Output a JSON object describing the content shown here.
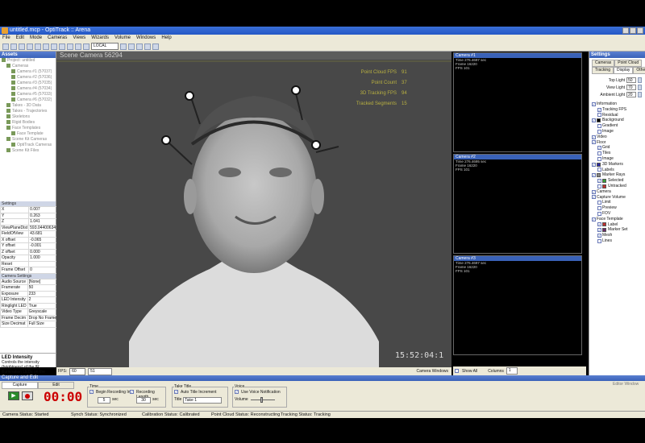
{
  "window": {
    "title": "untitled.mcp - OptiTrack :: Arena"
  },
  "menu": [
    "File",
    "Edit",
    "Mode",
    "Cameras",
    "Views",
    "Wizards",
    "Volume",
    "Windows",
    "Help"
  ],
  "toolbar": {
    "coord_select": "LOCAL"
  },
  "assets": {
    "title": "Assets",
    "tree": [
      "Project: untitled",
      "Cameras",
      "Camera #1 (57037)",
      "Camera #2 (57036)",
      "Camera #3 (57035)",
      "Camera #4 (57034)",
      "Camera #5 (57033)",
      "Camera #6 (57032)",
      "Takes - 3D Data",
      "Takes - Trajectories",
      "Skeletons",
      "Rigid Bodies",
      "Face Templates",
      "Face Template",
      "Scene Kit Cameras",
      "OptiTrack Cameras",
      "Scene Kit Files"
    ]
  },
  "properties": {
    "section1": "Settings",
    "rows1": [
      [
        "X",
        "0.007"
      ],
      [
        "Y",
        "0.263"
      ],
      [
        "Z",
        "1.041"
      ],
      [
        "ViewPlaneDist",
        "593.044006347"
      ],
      [
        "FieldOfView",
        "43.681"
      ],
      [
        "X offset",
        "-0.065"
      ],
      [
        "Y offset",
        "-0.001"
      ],
      [
        "Z offset",
        "0.000"
      ],
      [
        "Opacity",
        "1.000"
      ],
      [
        "Reset",
        ""
      ],
      [
        "Frame Offset",
        "0"
      ]
    ],
    "section2": "Camera Settings",
    "rows2": [
      [
        "Audio Source",
        "[None]"
      ],
      [
        "Framerate",
        "50"
      ],
      [
        "Exposure",
        "233"
      ],
      [
        "LED Intensity",
        "2"
      ],
      [
        "Ringlight LED",
        "True"
      ],
      [
        "Video Type",
        "Greyscale"
      ],
      [
        "Frame Decim",
        "Drop No Frames"
      ],
      [
        "Size Decimat",
        "Full Size"
      ]
    ],
    "desc_title": "LED Intensity",
    "desc_text": "Controls the intensity (brightness) of the IR illumination LEDs on the"
  },
  "scene": {
    "title": "Scene Camera 56294",
    "stats": [
      [
        "Point Cloud FPS",
        "91"
      ],
      [
        "Point Count",
        "37"
      ],
      [
        "3D Tracking FPS",
        "94"
      ],
      [
        "Tracked Segments",
        "15"
      ]
    ],
    "timecode": "15:52:04:1",
    "fps_label": "FPS:",
    "fps_value": "60",
    "fps_value2": "51",
    "camera_windows": "Camera Windows"
  },
  "cams": [
    {
      "title": "Camera #1",
      "info": [
        "Time 276.4697 sec",
        "Frame 16220",
        "FPS 101"
      ]
    },
    {
      "title": "Camera #2",
      "info": [
        "Time 276.4695 sec",
        "Frame 16220",
        "FPS 101"
      ]
    },
    {
      "title": "Camera #3",
      "info": [
        "Time 276.4697 sec",
        "Frame 16220",
        "FPS 101"
      ]
    }
  ],
  "cam_footer": {
    "show_all": "Show All",
    "columns_label": "Columns",
    "columns_value": "1"
  },
  "settings": {
    "title": "Settings",
    "tabs_top": [
      "Cameras",
      "Point Cloud"
    ],
    "tabs_bottom": [
      "Tracking",
      "Display",
      "Other"
    ],
    "lights": [
      [
        "Top Light",
        "50"
      ],
      [
        "View Light",
        "70"
      ],
      [
        "Ambient Light",
        "20"
      ]
    ],
    "items": [
      {
        "label": "Information",
        "lvl": 0,
        "chk": true
      },
      {
        "label": "Tracking FPS",
        "lvl": 1,
        "chk": true
      },
      {
        "label": "Residual",
        "lvl": 1,
        "chk": false
      },
      {
        "label": "Background",
        "lvl": 0,
        "chk": true,
        "color": "#000000"
      },
      {
        "label": "Gradient",
        "lvl": 1,
        "chk": false
      },
      {
        "label": "Image",
        "lvl": 1,
        "chk": false
      },
      {
        "label": "Video",
        "lvl": 0,
        "chk": true
      },
      {
        "label": "Floor",
        "lvl": 0,
        "chk": true
      },
      {
        "label": "Grid",
        "lvl": 1,
        "chk": true
      },
      {
        "label": "Tiles",
        "lvl": 1,
        "chk": false
      },
      {
        "label": "Image",
        "lvl": 1,
        "chk": false
      },
      {
        "label": "3D Markers",
        "lvl": 0,
        "chk": true,
        "color": "#2a2aa0"
      },
      {
        "label": "Labels",
        "lvl": 1,
        "chk": false
      },
      {
        "label": "Marker Rays",
        "lvl": 0,
        "chk": true,
        "color": "#888888"
      },
      {
        "label": "Selected",
        "lvl": 1,
        "chk": true,
        "color": "#3aa03a"
      },
      {
        "label": "Untracked",
        "lvl": 1,
        "chk": false,
        "color": "#c03030"
      },
      {
        "label": "Camera",
        "lvl": 0,
        "chk": true
      },
      {
        "label": "Capture Volume",
        "lvl": 0,
        "chk": true
      },
      {
        "label": "Limit",
        "lvl": 1,
        "chk": false
      },
      {
        "label": "Preview",
        "lvl": 1,
        "chk": false
      },
      {
        "label": "FOV",
        "lvl": 1,
        "chk": false
      },
      {
        "label": "Face Template",
        "lvl": 0,
        "chk": true
      },
      {
        "label": "Label",
        "lvl": 1,
        "chk": true,
        "color": "#c03030"
      },
      {
        "label": "Marker Set",
        "lvl": 1,
        "chk": true,
        "color": "#6a2a6a"
      },
      {
        "label": "Mesh",
        "lvl": 1,
        "chk": true
      },
      {
        "label": "Lines",
        "lvl": 1,
        "chk": false
      }
    ]
  },
  "capture": {
    "title": "Capture and Edit",
    "tabs": [
      "Capture",
      "Edit"
    ],
    "time_display": "00:00",
    "time_group": "Time",
    "begin_rec": "Begin Recording In",
    "begin_val": "5",
    "sec": "sec",
    "rec_len": "Recording Length",
    "rec_len_val": "30",
    "take_group": "Take Title",
    "auto_inc": "Auto Title Increment",
    "title_label": "Title",
    "title_value": "Take 1",
    "voice_group": "Voice",
    "use_voice": "Use Voice Notification",
    "volume": "Volume",
    "editor_window": "Editor Window"
  },
  "status": [
    "Camera Status: Started",
    "Synch Status: Synchronized",
    "Calibration Status: Calibrated",
    "Point Cloud Status: Reconstructing",
    "Tracking Status: Tracking"
  ],
  "colors": {
    "accent": "#3a62b8",
    "stats": "#b8b040",
    "record": "#cc0000"
  }
}
